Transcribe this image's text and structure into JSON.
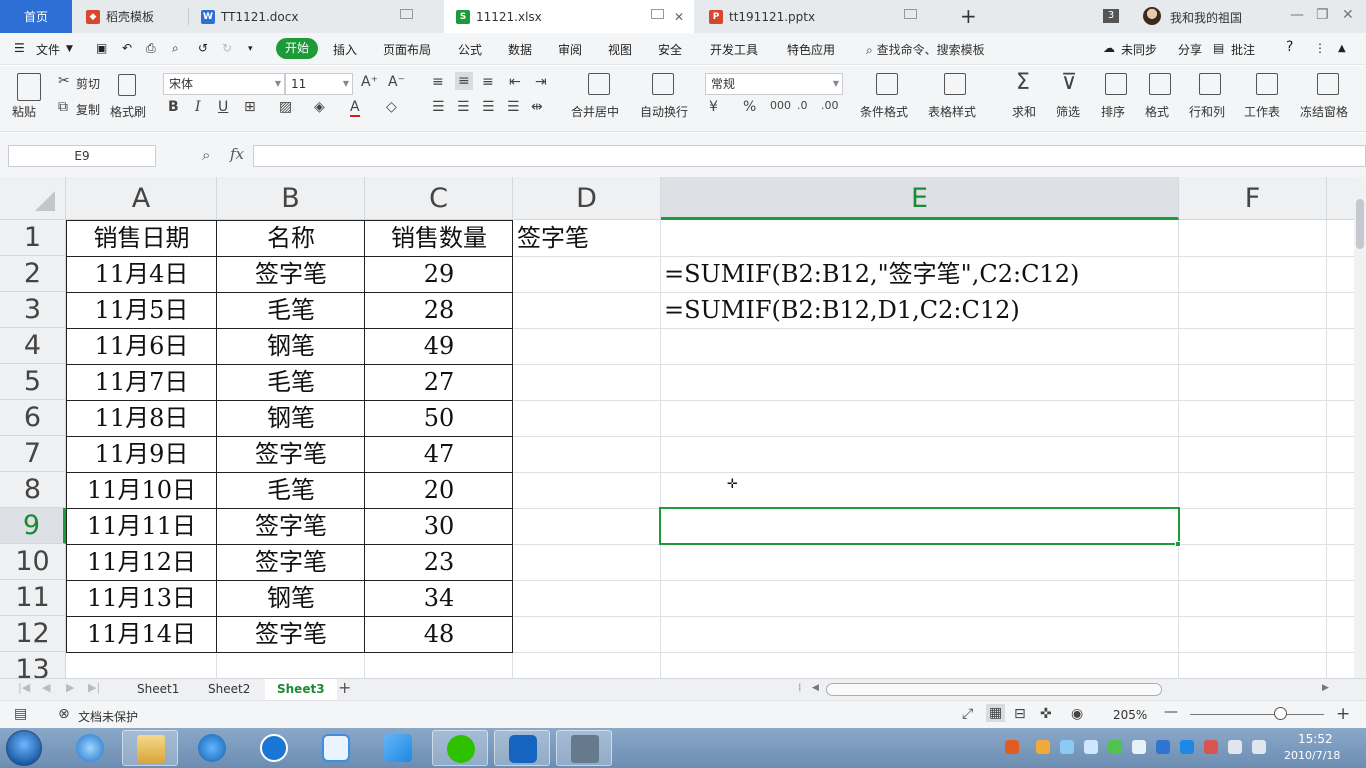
{
  "tabs": {
    "home": "首页",
    "items": [
      {
        "label": "稻壳模板",
        "icon": "daoke-icon"
      },
      {
        "label": "TT1121.docx",
        "icon": "word-doc-icon"
      },
      {
        "label": "11121.xlsx",
        "icon": "excel-sheet-icon",
        "active": true
      },
      {
        "label": "tt191121.pptx",
        "icon": "ppt-icon"
      }
    ],
    "window_count": "3",
    "user_name": "我和我的祖国"
  },
  "menubar": {
    "file": "文件",
    "start": "开始",
    "items": [
      "插入",
      "页面布局",
      "公式",
      "数据",
      "审阅",
      "视图",
      "安全",
      "开发工具",
      "特色应用"
    ],
    "search": "查找命令、搜索模板",
    "sync": "未同步",
    "share": "分享",
    "comment": "批注"
  },
  "ribbon": {
    "paste": "粘贴",
    "cut": "剪切",
    "copy": "复制",
    "format_painter": "格式刷",
    "font_name": "宋体",
    "font_size": "11",
    "merge_center": "合并居中",
    "wrap_text": "自动换行",
    "number_format": "常规",
    "cond_format": "条件格式",
    "table_style": "表格样式",
    "sum": "求和",
    "filter": "筛选",
    "sort": "排序",
    "format": "格式",
    "row_col": "行和列",
    "worksheet": "工作表",
    "freeze": "冻结窗格"
  },
  "formula_bar": {
    "name_box": "E9",
    "fx": "fx",
    "formula": ""
  },
  "sheet": {
    "columns": [
      "A",
      "B",
      "C",
      "D",
      "E",
      "F"
    ],
    "rows": [
      "1",
      "2",
      "3",
      "4",
      "5",
      "6",
      "7",
      "8",
      "9",
      "10",
      "11",
      "12",
      "13"
    ],
    "header": [
      "销售日期",
      "名称",
      "销售数量"
    ],
    "data": [
      [
        "11月4日",
        "签字笔",
        "29"
      ],
      [
        "11月5日",
        "毛笔",
        "28"
      ],
      [
        "11月6日",
        "钢笔",
        "49"
      ],
      [
        "11月7日",
        "毛笔",
        "27"
      ],
      [
        "11月8日",
        "钢笔",
        "50"
      ],
      [
        "11月9日",
        "签字笔",
        "47"
      ],
      [
        "11月10日",
        "毛笔",
        "20"
      ],
      [
        "11月11日",
        "签字笔",
        "30"
      ],
      [
        "11月12日",
        "签字笔",
        "23"
      ],
      [
        "11月13日",
        "钢笔",
        "34"
      ],
      [
        "11月14日",
        "签字笔",
        "48"
      ]
    ],
    "d1": "签字笔",
    "e2": "=SUMIF(B2:B12,\"签字笔\",C2:C12)",
    "e3": "=SUMIF(B2:B12,D1,C2:C12)",
    "selected_cell": "E9"
  },
  "sheet_tabs": [
    "Sheet1",
    "Sheet2",
    "Sheet3"
  ],
  "active_sheet": "Sheet3",
  "status": {
    "protect": "文档未保护",
    "zoom": "205%"
  },
  "clock": {
    "time": "15:52",
    "date": "2010/7/18"
  },
  "colors": {
    "accent_green": "#1d9b39",
    "home_tab_blue": "#2e6fd6"
  }
}
